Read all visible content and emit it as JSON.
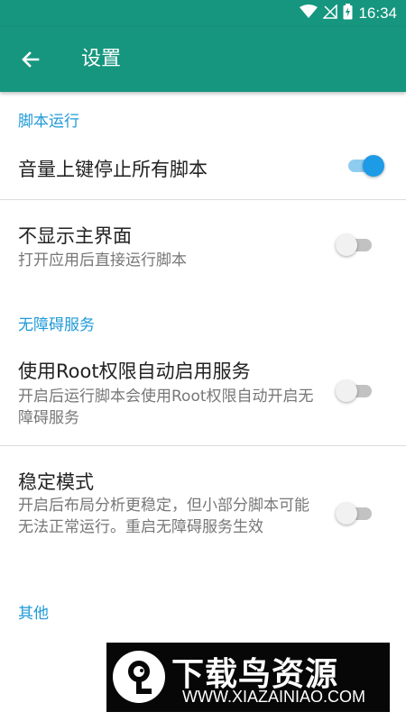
{
  "status_bar": {
    "time": "16:34"
  },
  "toolbar": {
    "title": "设置"
  },
  "sections": [
    {
      "header": "脚本运行",
      "items": [
        {
          "title": "音量上键停止所有脚本",
          "summary": "",
          "enabled": true
        },
        {
          "title": "不显示主界面",
          "summary": "打开应用后直接运行脚本",
          "enabled": false
        }
      ]
    },
    {
      "header": "无障碍服务",
      "items": [
        {
          "title": "使用Root权限自动启用服务",
          "summary": "开启后运行脚本会使用Root权限自动开启无障碍服务",
          "enabled": false
        },
        {
          "title": "稳定模式",
          "summary": "开启后布局分析更稳定，但小部分脚本可能无法正常运行。重启无障碍服务生效",
          "enabled": false
        }
      ]
    },
    {
      "header": "其他",
      "items": []
    }
  ],
  "watermark": {
    "brand": "下载鸟资源",
    "url": "WWW.XIAZAINIAO.COM"
  },
  "colors": {
    "primary": "#16967f",
    "accent": "#1e9be6",
    "section_header": "#1f9ad8"
  }
}
